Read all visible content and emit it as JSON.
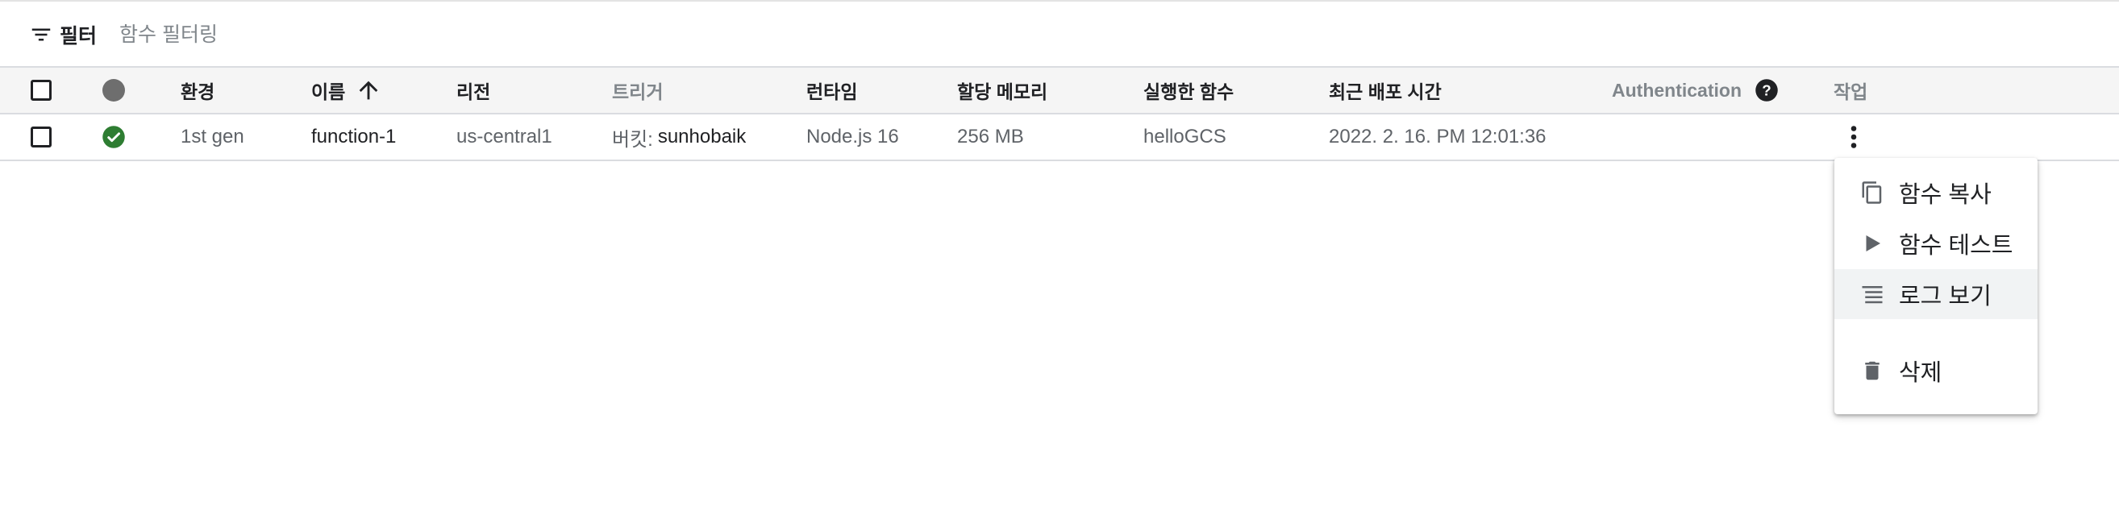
{
  "filter": {
    "button_label": "필터",
    "placeholder": "함수 필터링",
    "icon": "filter-icon"
  },
  "table": {
    "headers": {
      "status_icon": "circle-icon",
      "environment": "환경",
      "name": "이름",
      "name_sort": "arrow-up-icon",
      "region": "리전",
      "trigger": "트리거",
      "runtime": "런타임",
      "memory": "할당 메모리",
      "entry_point": "실행한 함수",
      "last_deployed": "최근 배포 시간",
      "authentication": "Authentication",
      "authentication_help": "help-icon",
      "actions": "작업"
    },
    "rows": [
      {
        "status": "check-circle-icon",
        "environment": "1st gen",
        "name": "function-1",
        "region": "us-central1",
        "trigger_prefix": "버킷:",
        "trigger_bucket": "sunhobaik",
        "runtime": "Node.js 16",
        "memory": "256 MB",
        "entry_point": "helloGCS",
        "last_deployed": "2022. 2. 16. PM 12:01:36",
        "actions_icon": "more-vert-icon"
      }
    ]
  },
  "menu": {
    "items": [
      {
        "label": "함수 복사",
        "icon": "copy-icon"
      },
      {
        "label": "함수 테스트",
        "icon": "play-icon"
      },
      {
        "label": "로그 보기",
        "icon": "logs-icon",
        "highlighted": true
      },
      {
        "label": "삭제",
        "icon": "delete-icon"
      }
    ]
  },
  "colors": {
    "success": "#2e7d32",
    "status_dot": "#6e6e6e",
    "header_bg": "#f5f5f5",
    "muted_text": "#80868b",
    "hover_bg": "#f1f3f4"
  }
}
